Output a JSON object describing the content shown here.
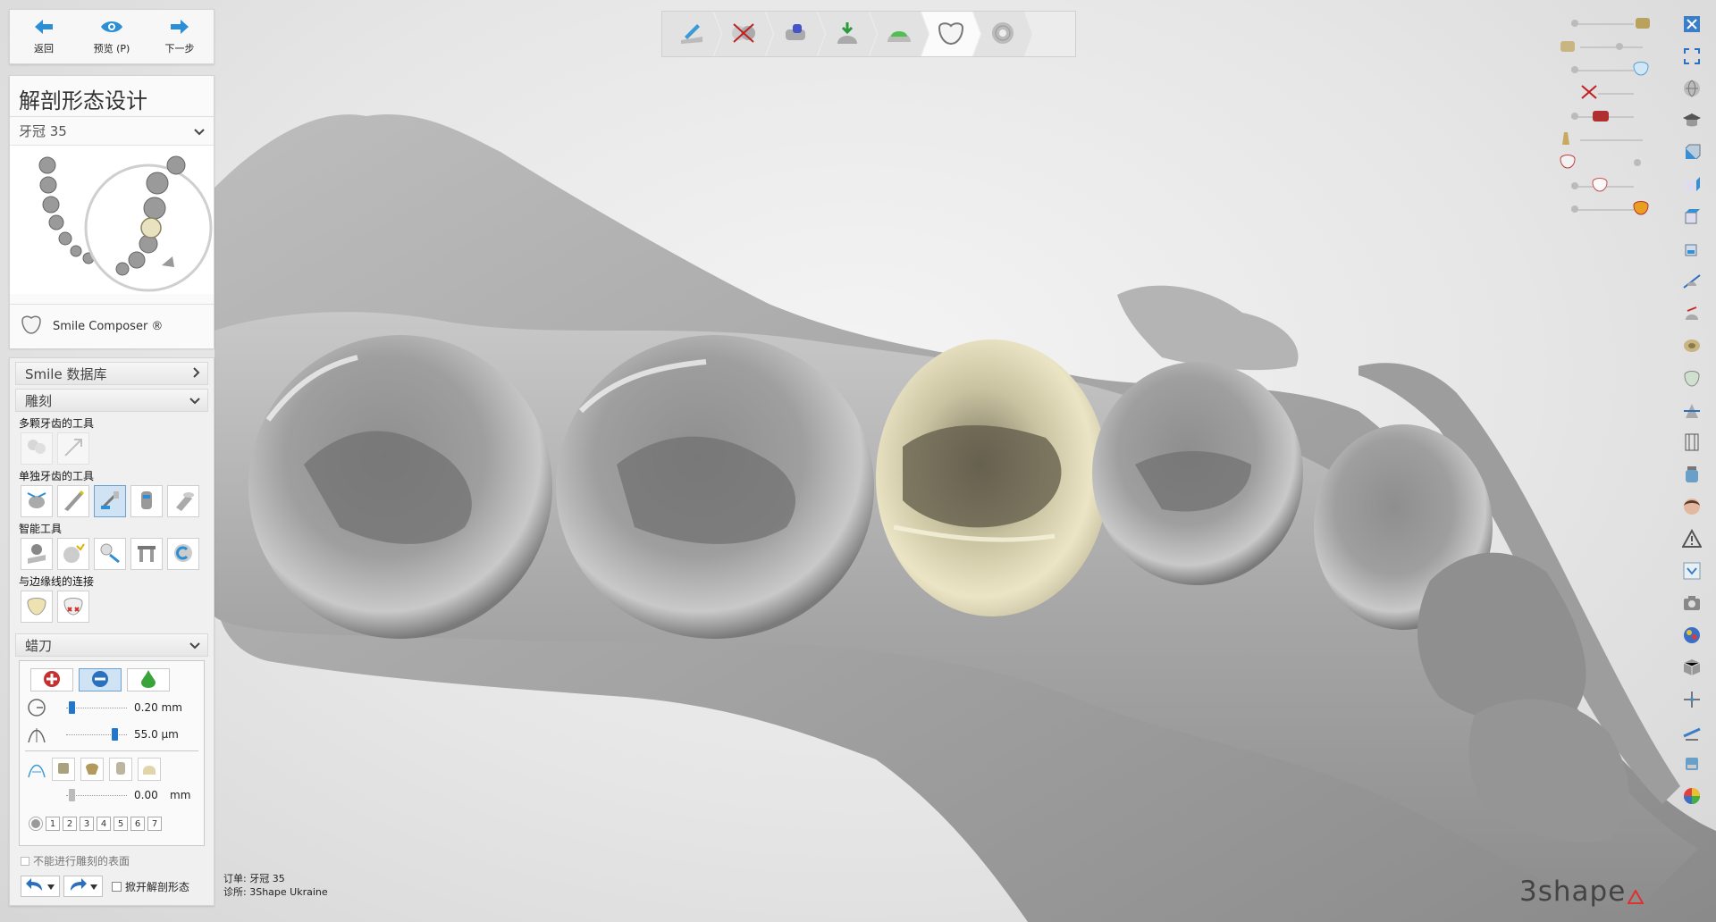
{
  "nav": {
    "back_label": "返回",
    "preview_label": "预览 (P)",
    "next_label": "下一步"
  },
  "design_panel": {
    "title": "解剖形态设计",
    "tooth_selector": "牙冠 35",
    "smile_composer": "Smile Composer ®"
  },
  "tools_panel": {
    "smile_db": "Smile 数据库",
    "sculpt": "雕刻",
    "multi_tooth_tools": "多颗牙齿的工具",
    "single_tooth_tools": "单独牙齿的工具",
    "smart_tools": "智能工具",
    "margin_connect": "与边缘线的连接",
    "wax_knife": "蜡刀",
    "radius_value": "0.20 mm",
    "strength_value": "55.0 μm",
    "offset_value": "0.00",
    "offset_unit": "mm",
    "brush_numbers": [
      "1",
      "2",
      "3",
      "4",
      "5",
      "6",
      "7"
    ],
    "no_sculpt_surface": "不能进行雕刻的表面",
    "open_anatomy": "掀开解剖形态"
  },
  "levels": {
    "radius_fraction": 0.05,
    "strength_fraction": 0.85,
    "offset_fraction": 0.05
  },
  "workflow": {
    "active_step": 5,
    "steps": [
      "margin-step-icon",
      "cut-step-icon",
      "insertion-step-icon",
      "cement-step-icon",
      "die-step-icon",
      "anatomy-step-icon",
      "finish-step-icon"
    ]
  },
  "order": {
    "order_label": "订单:",
    "order_value": "牙冠 35",
    "clinic_label": "诊所:",
    "clinic_value": "3Shape Ukraine"
  },
  "brand": "3shape",
  "colors": {
    "accent": "#2277cc",
    "crown": "#e8e2c0",
    "model": "#a9a9a9"
  }
}
